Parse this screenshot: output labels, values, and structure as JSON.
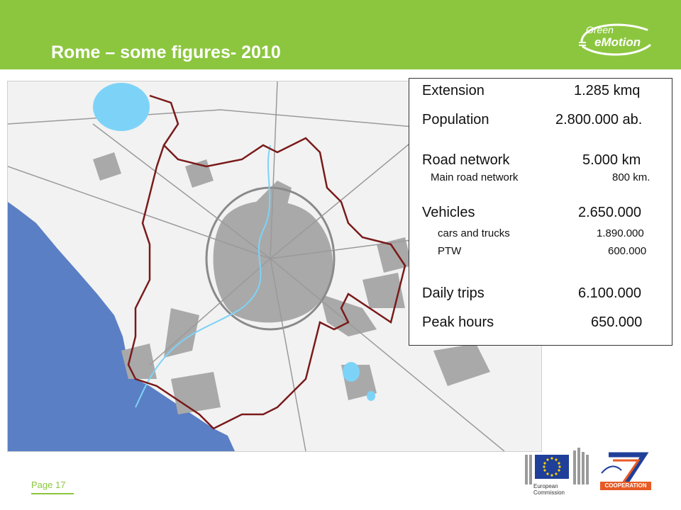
{
  "slide": {
    "title": "Rome – some figures- 2010",
    "page_label": "Page 17"
  },
  "logo": {
    "line1": "Green",
    "line2": "eMotion"
  },
  "figures": {
    "extension": {
      "label": "Extension",
      "value": "1.285 kmq"
    },
    "population": {
      "label": "Population",
      "value": "2.800.000 ab."
    },
    "road_network": {
      "label": "Road network",
      "value": "5.000 km"
    },
    "main_road": {
      "label": "Main road network",
      "value": "800 km."
    },
    "vehicles": {
      "label": "Vehicles",
      "value": "2.650.000"
    },
    "cars_trucks": {
      "label": "cars and trucks",
      "value": "1.890.000"
    },
    "ptw": {
      "label": "PTW",
      "value": "600.000"
    },
    "daily_trips": {
      "label": "Daily trips",
      "value": "6.100.000"
    },
    "peak_hours": {
      "label": "Peak hours",
      "value": "650.000"
    }
  },
  "footer_logos": {
    "eu_caption_1": "European",
    "eu_caption_2": "Commission",
    "fp7_caption": "COOPERATION"
  },
  "colors": {
    "header_green": "#8cc63f",
    "sea_blue": "#5b7fc4",
    "lake_blue": "#7dd3f7",
    "boundary_red": "#7a1a1a",
    "urban_gray": "#a9a9a9"
  }
}
